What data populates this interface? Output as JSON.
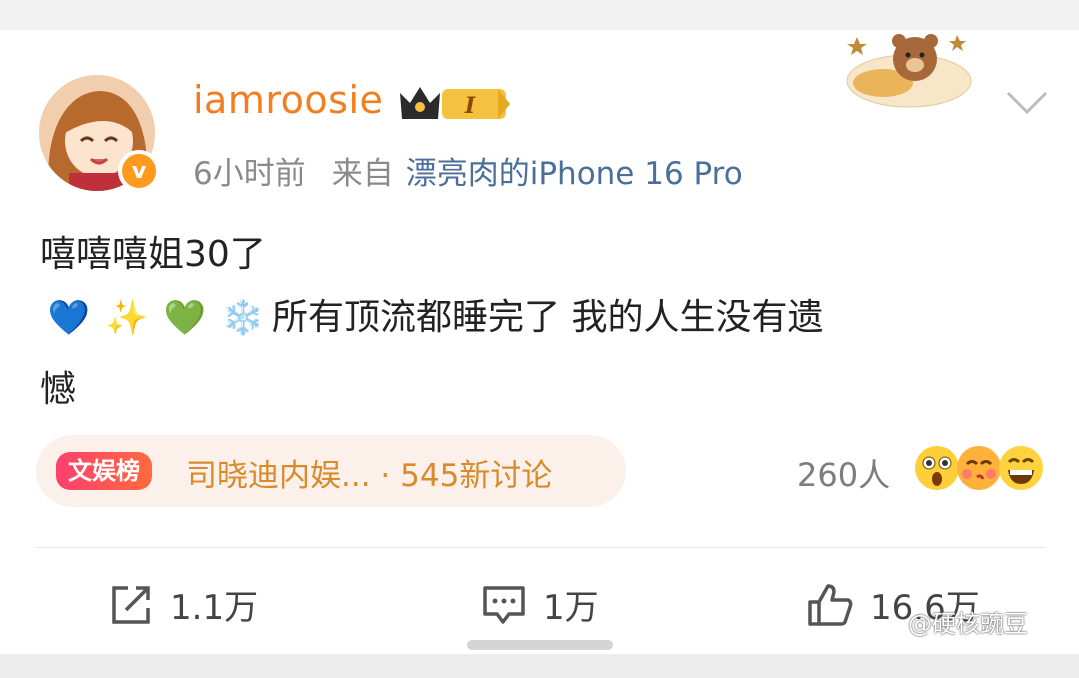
{
  "post": {
    "username": "iamroosie",
    "level_badge": "I",
    "time": "6小时前",
    "source_label": "来自",
    "device": "漂亮肉的iPhone 16 Pro",
    "verified_mark": "v",
    "text_line1": "嘻嘻嘻姐30了",
    "emojis": [
      "💙",
      "✨",
      "💚",
      "❄️"
    ],
    "text_line2": "所有顶流都睡完了 我的人生没有遗",
    "text_line3": "憾"
  },
  "topic": {
    "badge": "文娱榜",
    "title": "司晓迪内娱... · 545新讨论"
  },
  "reactions": {
    "count": "260人",
    "faces": [
      "surprised-face-icon",
      "kiss-face-icon",
      "grin-face-icon"
    ]
  },
  "actions": {
    "repost_count": "1.1万",
    "comment_count": "1万",
    "like_count": "16.6万"
  },
  "watermark": "@硬核豌豆",
  "colors": {
    "username": "#f37e1f",
    "device_link": "#4a6f9b",
    "topic_text": "#d98a2a",
    "verified": "#ff9a1f"
  }
}
